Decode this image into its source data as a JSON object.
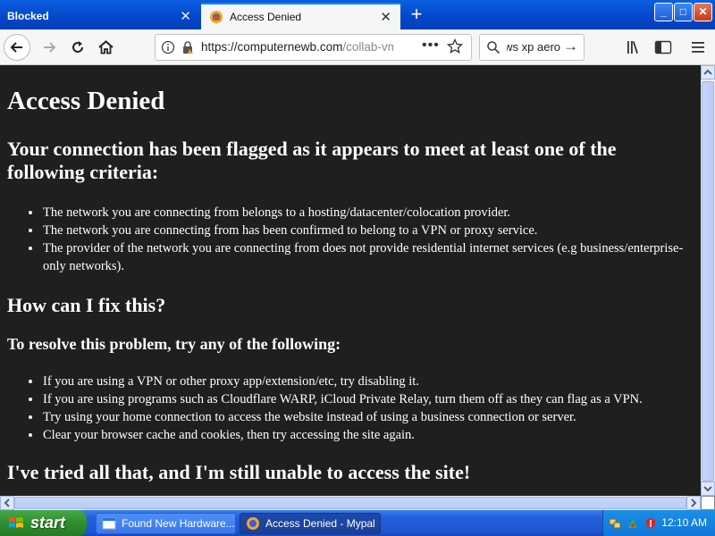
{
  "tabs": [
    {
      "label": "Blocked",
      "active": false
    },
    {
      "label": "Access Denied",
      "active": true
    }
  ],
  "new_tab_symbol": "+",
  "window_controls": {
    "minimize": "_",
    "maximize": "□",
    "close": "✕"
  },
  "urlbar": {
    "host": "https://computernewb.com",
    "path": "/collab-vm",
    "icons": [
      "info-icon",
      "lock-icon",
      "page-actions-icon",
      "bookmark-star-icon"
    ]
  },
  "searchbar": {
    "value": "windows xp aero"
  },
  "toolbar_icons": [
    "library-icon",
    "sidebar-icon",
    "menu-icon"
  ],
  "page": {
    "title": "Access Denied",
    "criteria_heading": "Your connection has been flagged as it appears to meet at least one of the following criteria:",
    "criteria": [
      "The network you are connecting from belongs to a hosting/datacenter/colocation provider.",
      "The network you are connecting from has been confirmed to belong to a VPN or proxy service.",
      "The provider of the network you are connecting from does not provide residential internet services (e.g business/enterprise-only networks)."
    ],
    "fix_heading": "How can I fix this?",
    "resolve_heading": "To resolve this problem, try any of the following:",
    "resolve_items": [
      "If you are using a VPN or other proxy app/extension/etc, try disabling it.",
      "If you are using programs such as Cloudflare WARP, iCloud Private Relay, turn them off as they can flag as a VPN.",
      "Try using your home connection to access the website instead of using a business connection or server.",
      "Clear your browser cache and cookies, then try accessing the site again."
    ],
    "tried_heading": "I've tried all that, and I'm still unable to access the site!"
  },
  "taskbar": {
    "start_label": "start",
    "tasks": [
      {
        "label": "Found New Hardware...",
        "active": false
      },
      {
        "label": "Access Denied - Mypal",
        "active": true
      }
    ],
    "clock": "12:10 AM"
  },
  "colors": {
    "page_background": "#1f1f1f",
    "page_text": "#ffffff",
    "titlebar_blue": "#0446c9",
    "start_green": "#2e8d2f"
  }
}
